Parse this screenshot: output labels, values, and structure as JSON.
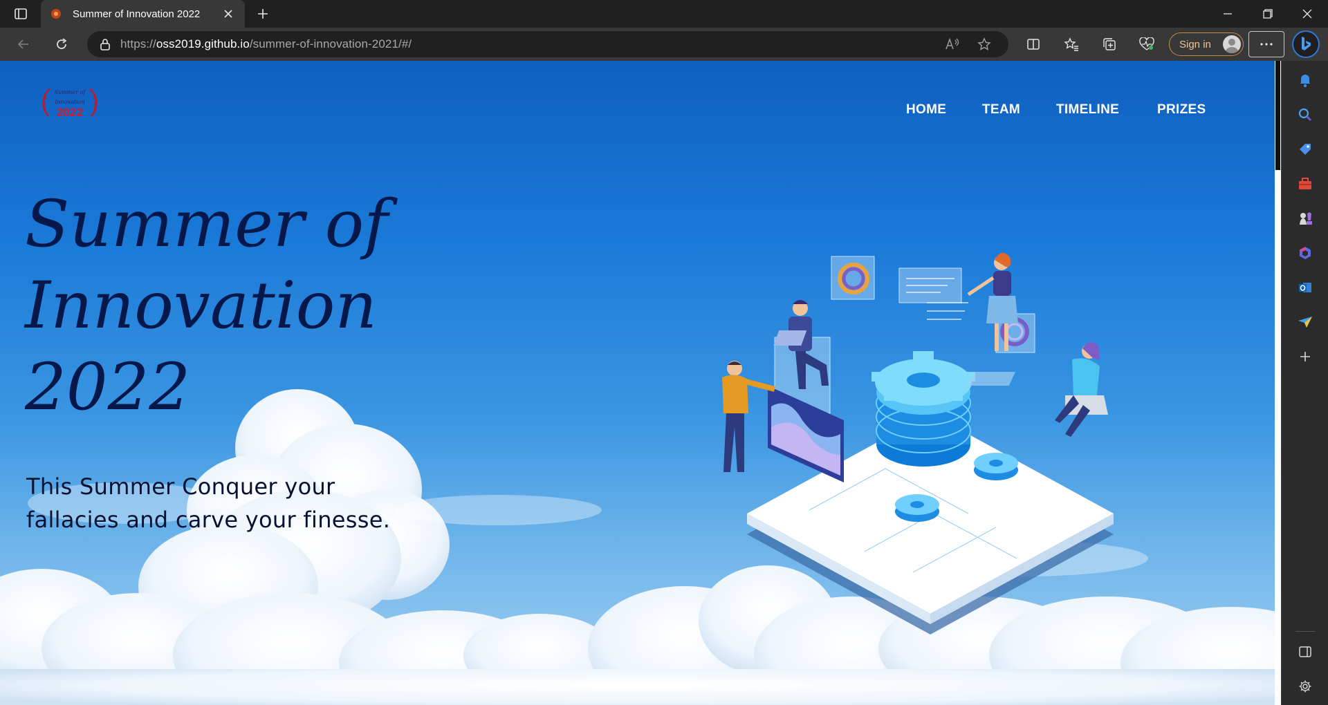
{
  "browser": {
    "tab": {
      "title": "Summer of Innovation 2022"
    },
    "address": {
      "url_prefix": "https://",
      "url_host": "oss2019.github.io",
      "url_path": "/summer-of-innovation-2021/#/"
    },
    "signin_label": "Sign in"
  },
  "page": {
    "logo": {
      "text_top": "Summer of",
      "text_mid": "Innovation",
      "text_year": "2022"
    },
    "nav": [
      {
        "label": "HOME"
      },
      {
        "label": "TEAM"
      },
      {
        "label": "TIMELINE"
      },
      {
        "label": "PRIZES"
      }
    ],
    "hero": {
      "title_line1": "Summer of",
      "title_line2": "Innovation",
      "title_line3": "2022",
      "subtitle_line1": "This Summer Conquer your",
      "subtitle_line2": "fallacies and carve your finesse."
    }
  },
  "colors": {
    "title": "#06174a",
    "accent_signin": "#c98a46",
    "bing": "#2f79d8"
  }
}
